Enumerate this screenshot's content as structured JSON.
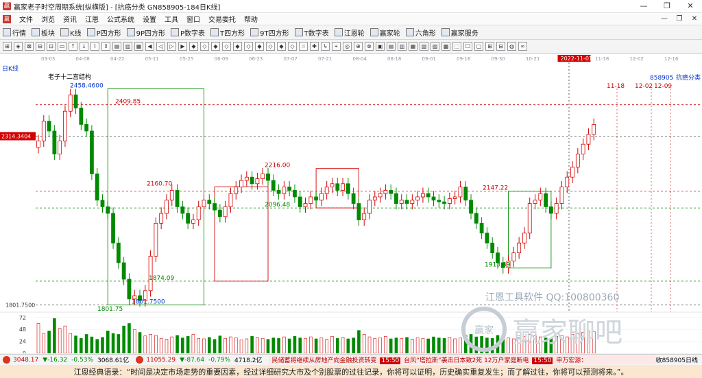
{
  "window": {
    "title": "赢家老子时空周期系统[纵横版] - [抗癌分类  GN858905-184日K线]",
    "controls": [
      "—",
      "❐",
      "✕"
    ]
  },
  "menubar": {
    "items": [
      "文件",
      "浏览",
      "资讯",
      "江恩",
      "公式系统",
      "设置",
      "工具",
      "窗口",
      "交易委托",
      "帮助"
    ],
    "right_controls": [
      "—",
      "❐",
      "✕"
    ]
  },
  "toolbar1": {
    "items": [
      {
        "label": "行情",
        "icon": "quotes-icon"
      },
      {
        "label": "板块",
        "icon": "sector-icon"
      },
      {
        "label": "K线",
        "icon": "kline-icon"
      },
      {
        "label": "P四方形",
        "icon": "p-square-icon"
      },
      {
        "label": "9P四方形",
        "icon": "9p-square-icon"
      },
      {
        "label": "P数字表",
        "icon": "p-table-icon"
      },
      {
        "label": "T四方形",
        "icon": "t-square-icon"
      },
      {
        "label": "9T四方形",
        "icon": "9t-square-icon"
      },
      {
        "label": "T数字表",
        "icon": "t-table-icon"
      },
      {
        "label": "江恩轮",
        "icon": "gann-wheel-icon"
      },
      {
        "label": "赢家轮",
        "icon": "winner-wheel-icon"
      },
      {
        "label": "六角形",
        "icon": "hexagon-icon"
      },
      {
        "label": "赢家服务",
        "icon": "service-icon"
      }
    ]
  },
  "toolbar2": {
    "buttons": [
      "⊞",
      "◈",
      "⊠",
      "⊟",
      "⊡",
      "▭",
      "↑",
      "↓",
      "⌇",
      "⇕",
      "▤",
      "▥",
      "▦",
      "◀",
      "◁",
      "▷",
      "▶",
      "◆",
      "◇",
      "◆",
      "◇",
      "◆",
      "◇",
      "◆",
      "◇",
      "◆",
      "◇",
      "☝",
      "✚",
      "↳",
      "⌖",
      "◎",
      "⊕",
      "⊗",
      "▣",
      "▤",
      "▥",
      "▦",
      "▧",
      "▨",
      "▩",
      "⬚",
      "☐",
      "▢",
      "⊞",
      "⊟",
      "◍",
      "∞"
    ]
  },
  "status": {
    "index1": {
      "value": "3048.17",
      "change": "▼-16.32",
      "pct": "-0.53%",
      "amount": "3068.61亿"
    },
    "index2": {
      "value": "11055.29",
      "change": "▼-87.64",
      "pct": "-0.79%",
      "amount": "4718.2亿"
    },
    "ticker": [
      "民储蓄将继续从房地产向金融投资转变",
      "15:50",
      "台风“塔拉斯”袭击日本致2死 12万户家庭断电",
      "15:50",
      "申万宏源："
    ],
    "right": "收858905日线"
  },
  "bottom": {
    "quote": "江恩经典语录：“时间是决定市场走势的重要因素，经过详细研究大市及个别股票的过往记录，你将可以证明，历史确实重复发生；而了解过往，你将可以预测将来。”。"
  },
  "watermark": {
    "tool_text": "江恩工具软件  QQ:100800360",
    "logo_text": "赢家聊吧",
    "logo_badge": "赢家"
  },
  "chart_data": {
    "type": "candlestick",
    "period_label": "日K线",
    "structure_title": "老子十二宫结构",
    "instrument": "858905",
    "instrument_name": "抗癌分类",
    "x_ticks": [
      "03-03",
      "04-08",
      "04-22",
      "05-11",
      "05-25",
      "06-09",
      "06-23",
      "07-07",
      "07-21",
      "08-04",
      "08-18",
      "09-01",
      "09-16",
      "09-30",
      "10-21",
      "2022-11-01",
      "11-18",
      "12-02",
      "12-16"
    ],
    "forecast_dates": [
      "11-18",
      "12-02",
      "12-09"
    ],
    "y_ticks": [
      "1801.7500",
      "72",
      "48",
      "24",
      "0"
    ],
    "current_price_label": "2314.3404",
    "price_labels": [
      "2458.4600",
      "2409.85",
      "2160.70",
      "2216.00",
      "2096.48",
      "2147.22",
      "1874.09",
      "1913.89",
      "1801.7500",
      "1801.75"
    ],
    "ylim": [
      1780,
      2480
    ],
    "close": [
      2300,
      2360,
      2330,
      2260,
      2300,
      2390,
      2440,
      2400,
      2350,
      2330,
      2200,
      2120,
      2100,
      2080,
      1990,
      1930,
      1880,
      1820,
      1830,
      1815,
      1845,
      1950,
      2050,
      2080,
      2120,
      2150,
      2100,
      2080,
      2050,
      2060,
      2100,
      2120,
      2110,
      2090,
      2070,
      2100,
      2140,
      2160,
      2180,
      2190,
      2170,
      2185,
      2200,
      2180,
      2150,
      2140,
      2160,
      2150,
      2130,
      2100,
      2110,
      2130,
      2120,
      2140,
      2160,
      2170,
      2150,
      2170,
      2140,
      2110,
      2060,
      2080,
      2120,
      2130,
      2140,
      2150,
      2140,
      2110,
      2120,
      2110,
      2120,
      2130,
      2140,
      2130,
      2120,
      2115,
      2110,
      2125,
      2130,
      2160,
      2120,
      2080,
      2050,
      2020,
      1990,
      1960,
      1930,
      1915,
      1935,
      1960,
      1990,
      2020,
      2110,
      2120,
      2140,
      2100,
      2080,
      2110,
      2160,
      2190,
      2220,
      2260,
      2290,
      2320,
      2350
    ],
    "volume": [
      60,
      40,
      45,
      70,
      50,
      55,
      40,
      35,
      30,
      38,
      33,
      28,
      32,
      45,
      40,
      38,
      55,
      60,
      48,
      42,
      35,
      38,
      36,
      30,
      28,
      33,
      36,
      31,
      34,
      38,
      30,
      29,
      32,
      28,
      35,
      30,
      33,
      31,
      27,
      29,
      34,
      32,
      30,
      28,
      31,
      30,
      33,
      29,
      34,
      31,
      30,
      33,
      29,
      31,
      28,
      34,
      30,
      32,
      29,
      31,
      46,
      38,
      33,
      30,
      31,
      34,
      29,
      31,
      30,
      32,
      28,
      31,
      30,
      29,
      33,
      31,
      30,
      32,
      29,
      31,
      36,
      38,
      33,
      34,
      31,
      30,
      36,
      33,
      31,
      29,
      32,
      34,
      38,
      35,
      33,
      31,
      30,
      34,
      36,
      33,
      38,
      40,
      42,
      45,
      44
    ]
  }
}
